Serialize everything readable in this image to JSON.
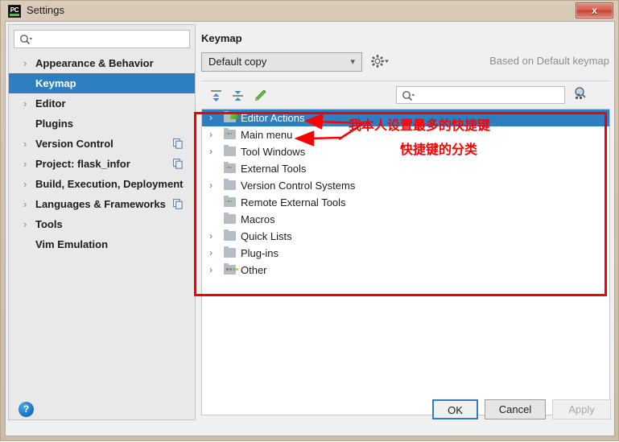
{
  "window": {
    "title": "Settings",
    "app_icon": "pycharm-icon",
    "app_icon_text": "PC",
    "close_label": "x"
  },
  "sidebar": {
    "search": {
      "placeholder": "",
      "value": "",
      "icon": "search-icon"
    },
    "items": [
      {
        "label": "Appearance & Behavior",
        "expandable": true,
        "selected": false,
        "copyable": false
      },
      {
        "label": "Keymap",
        "expandable": false,
        "selected": true,
        "copyable": false
      },
      {
        "label": "Editor",
        "expandable": true,
        "selected": false,
        "copyable": false
      },
      {
        "label": "Plugins",
        "expandable": false,
        "selected": false,
        "copyable": false
      },
      {
        "label": "Version Control",
        "expandable": true,
        "selected": false,
        "copyable": true
      },
      {
        "label": "Project: flask_infor",
        "expandable": true,
        "selected": false,
        "copyable": true
      },
      {
        "label": "Build, Execution, Deployment",
        "expandable": true,
        "selected": false,
        "copyable": false
      },
      {
        "label": "Languages & Frameworks",
        "expandable": true,
        "selected": false,
        "copyable": true
      },
      {
        "label": "Tools",
        "expandable": true,
        "selected": false,
        "copyable": false
      },
      {
        "label": "Vim Emulation",
        "expandable": false,
        "selected": false,
        "copyable": false
      }
    ]
  },
  "main": {
    "title": "Keymap",
    "keymap_select": {
      "value": "Default copy",
      "chevron": "chevron-down-icon"
    },
    "gear_icon": "gear-icon",
    "based_on": "Based on Default keymap",
    "toolbar": [
      {
        "name": "expand-all-icon",
        "tooltip": "Expand All"
      },
      {
        "name": "collapse-all-icon",
        "tooltip": "Collapse All"
      },
      {
        "name": "edit-shortcut-icon",
        "tooltip": "Edit Shortcut"
      }
    ],
    "filter": {
      "placeholder": "",
      "value": "",
      "icon": "search-icon"
    },
    "find_by_shortcut_icon": "find-by-shortcut-icon",
    "tree": [
      {
        "label": "Editor Actions",
        "expandable": true,
        "selected": true,
        "icon": "folder-pencil-icon"
      },
      {
        "label": "Main menu",
        "expandable": true,
        "selected": false,
        "icon": "folder-dots-icon"
      },
      {
        "label": "Tool Windows",
        "expandable": true,
        "selected": false,
        "icon": "folder-icon"
      },
      {
        "label": "External Tools",
        "expandable": false,
        "selected": false,
        "icon": "folder-dots-icon"
      },
      {
        "label": "Version Control Systems",
        "expandable": true,
        "selected": false,
        "icon": "folder-icon"
      },
      {
        "label": "Remote External Tools",
        "expandable": false,
        "selected": false,
        "icon": "folder-dots-icon"
      },
      {
        "label": "Macros",
        "expandable": false,
        "selected": false,
        "icon": "folder-icon"
      },
      {
        "label": "Quick Lists",
        "expandable": true,
        "selected": false,
        "icon": "folder-icon"
      },
      {
        "label": "Plug-ins",
        "expandable": true,
        "selected": false,
        "icon": "folder-icon"
      },
      {
        "label": "Other",
        "expandable": true,
        "selected": false,
        "icon": "folder-squares-icon"
      }
    ]
  },
  "annotations": {
    "color": "#ff0000",
    "note_top": "我本人设置最多的快捷键",
    "note_bottom": "快捷键的分类"
  },
  "footer": {
    "help_icon": "help-icon",
    "help_glyph": "?",
    "ok": "OK",
    "cancel": "Cancel",
    "apply": "Apply"
  }
}
